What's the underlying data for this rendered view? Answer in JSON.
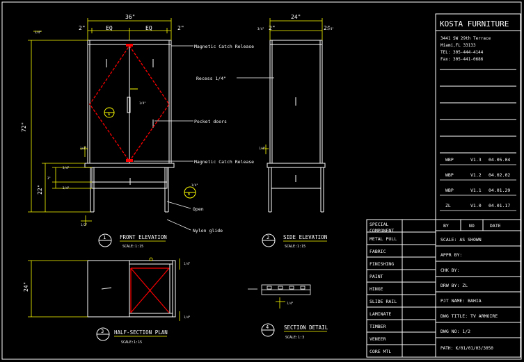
{
  "company": {
    "name": "KOSTA FURNITURE",
    "address1": "3441 SW 29th Terrace",
    "address2": "Miami,FL   33133",
    "tel": "TEL: 305-444-4144",
    "fax": "Fax: 305-441-0686"
  },
  "revisions": [
    {
      "by": "WBP",
      "no": "V1.3",
      "date": "04.05.04"
    },
    {
      "by": "WBP",
      "no": "V1.2",
      "date": "04.02.02"
    },
    {
      "by": "WBP",
      "no": "V1.1",
      "date": "04.01.29"
    },
    {
      "by": "ZL",
      "no": "V1.0",
      "date": "04.01.17"
    }
  ],
  "revision_header": {
    "by": "BY",
    "no": "NO",
    "date": "DATE"
  },
  "title_block": {
    "scale": "SCALE:     AS SHOWN",
    "appr": "APPR BY:",
    "chk": "CHK BY:",
    "drw": "DRW BY:      ZL",
    "prj": "PJT NAME:  BAHIA",
    "dwg_title": "DWG TITLE: TV ARMOIRE",
    "dwg_no": "DWG NO:     1/2",
    "path": "PATH: K/01/01/03/3050"
  },
  "spec_items": [
    "SPECIAL\nCOMPONENT",
    "METAL PULL",
    "FABRIC",
    "FINISHING",
    "PAINT",
    "HINGE",
    "SLIDE RAIL",
    "LAMINATE",
    "TIMBER",
    "VENEER",
    "CORE MTL"
  ],
  "views": {
    "front": {
      "num": "1",
      "title": "FRONT ELEVATION",
      "scale": "SCALE:1:15"
    },
    "side": {
      "num": "2",
      "title": "SIDE ELEVATION",
      "scale": "SCALE:1:15"
    },
    "half": {
      "num": "3",
      "title": "HALF-SECTION PLAN",
      "scale": "SCALE:1:15"
    },
    "detail": {
      "num": "4",
      "title": "SECTION DETAIL",
      "scale": "SCALE:1:3"
    }
  },
  "callouts": {
    "catch_top": "Magnetic Catch Release",
    "recess": "Recess 1/4\"",
    "pocket": "Pocket doors",
    "catch_bottom": "Magnetic Catch Release",
    "open": "Open",
    "nylon": "Nylon glide"
  },
  "dims": {
    "front_width": "36\"",
    "eq_left": "EQ",
    "eq_right": "EQ",
    "side_width": "24\"",
    "height": "72\"",
    "left_2": "2\"",
    "right_2": "2\"",
    "side_2a": "2\"",
    "side_2b": "2\"",
    "half_24": "24\"",
    "lower_22": "22\""
  }
}
